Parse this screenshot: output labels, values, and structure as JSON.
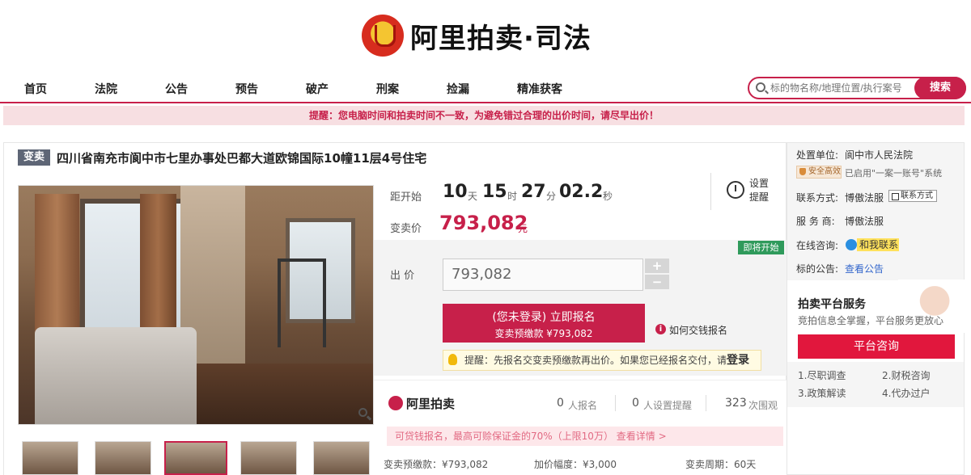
{
  "header": {
    "brand": "阿里拍卖·司法",
    "logo_icon": "court-emblem-icon"
  },
  "nav": {
    "items": [
      "首页",
      "法院",
      "公告",
      "预告",
      "破产",
      "刑案",
      "捡漏",
      "精准获客"
    ],
    "search_placeholder": "标的物名称/地理位置/执行案号",
    "search_button": "搜索"
  },
  "notice": "提醒：您电脑时间和拍卖时间不一致，为避免错过合理的出价时间，请尽早出价！",
  "item": {
    "tag": "变卖",
    "title": "四川省南充市阆中市七里办事处巴都大道欧锦国际10幢11层4号住宅",
    "countdown": {
      "label": "距开始",
      "days": "10",
      "days_unit": "天",
      "hours": "15",
      "hours_unit": "时",
      "minutes": "27",
      "minutes_unit": "分",
      "seconds": "02.2",
      "seconds_unit": "秒"
    },
    "reminder": "设置提醒",
    "price_label": "变卖价",
    "price": "793,082",
    "price_unit": "元",
    "badge": "即将开始",
    "bid_label": "出 价",
    "bid_value": "793,082",
    "stepper_plus": "+",
    "stepper_minus": "−",
    "signup_line1": "(您未登录) 立即报名",
    "signup_line2": "变卖预缴款 ¥793,082",
    "howpay": "如何交钱报名",
    "tip": "提醒：先报名交变卖预缴款再出价。如果您已经报名交付，请",
    "tip_login": "登录",
    "stats": {
      "brand": "阿里拍卖",
      "signups": "0",
      "signups_label": "人报名",
      "reminders": "0",
      "reminders_label": "人设置提醒",
      "views": "323",
      "views_label": "次围观"
    },
    "promo": "可贷钱报名，最高可赊保证金的70%（上限10万）  查看详情 >",
    "bottom": {
      "deposit": "变卖预缴款：¥793,082",
      "increment": "加价幅度：¥3,000",
      "period": "变卖周期：60天"
    }
  },
  "side": {
    "unit_label": "处置单位:",
    "unit_value": "阆中市人民法院",
    "secure_badge": "安全高效",
    "account_text": "已启用\"一案一账号\"系统",
    "contact_label": "联系方式:",
    "contact_value": "博傲法服",
    "contact_btn": "联系方式",
    "provider_label": "服 务 商:",
    "provider_value": "博傲法服",
    "consult_label": "在线咨询:",
    "chat_btn": "和我联系",
    "notice_label": "标的公告:",
    "notice_link": "查看公告",
    "service_title": "拍卖平台服务",
    "service_sub": "竞拍信息全掌握，平台服务更放心",
    "consult_btn": "平台咨询",
    "services": [
      "1.尽职调查",
      "2.财税咨询",
      "3.政策解读",
      "4.代办过户"
    ]
  }
}
